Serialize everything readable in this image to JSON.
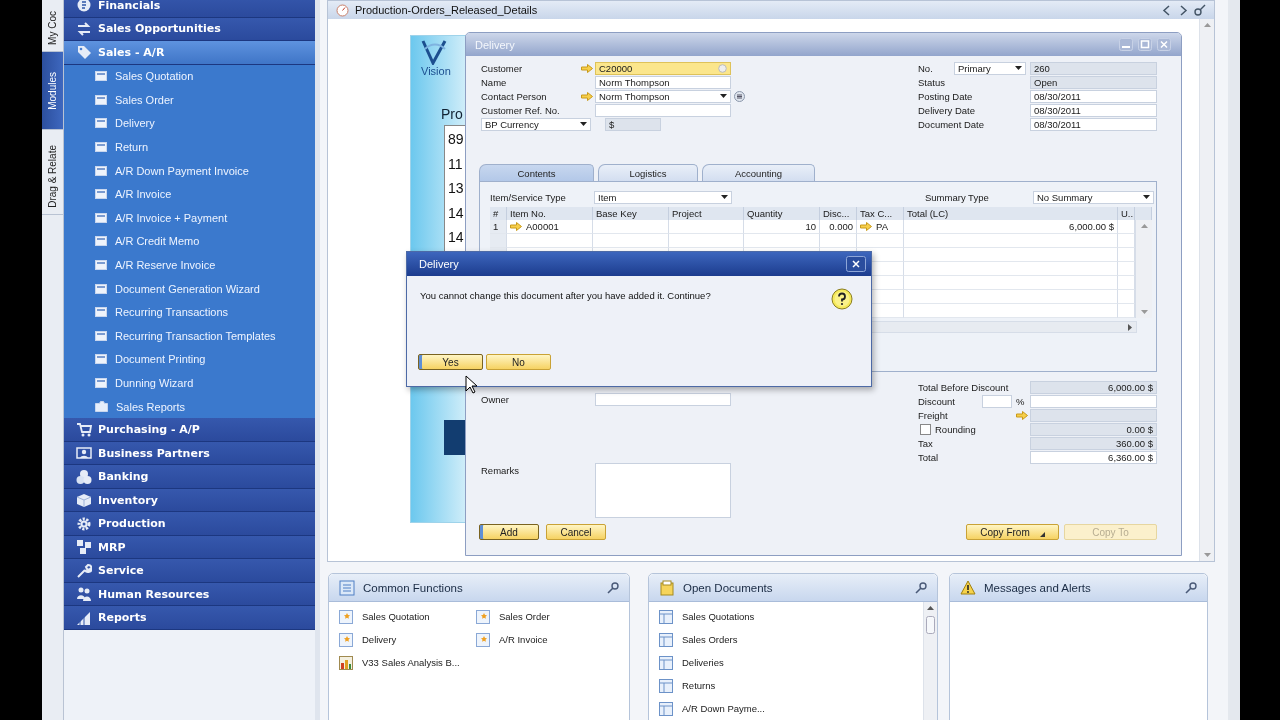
{
  "side_tabs": [
    {
      "label": "My Coc",
      "selected": false
    },
    {
      "label": "Modules",
      "selected": true
    },
    {
      "label": "Drag & Relate",
      "selected": false
    }
  ],
  "modules": [
    {
      "label": "Financials",
      "expanded": false
    },
    {
      "label": "Sales Opportunities",
      "expanded": false
    },
    {
      "label": "Sales - A/R",
      "expanded": true,
      "children": [
        {
          "label": "Sales Quotation",
          "kind": "form"
        },
        {
          "label": "Sales Order",
          "kind": "form"
        },
        {
          "label": "Delivery",
          "kind": "form"
        },
        {
          "label": "Return",
          "kind": "form"
        },
        {
          "label": "A/R Down Payment Invoice",
          "kind": "form"
        },
        {
          "label": "A/R Invoice",
          "kind": "form"
        },
        {
          "label": "A/R Invoice + Payment",
          "kind": "form"
        },
        {
          "label": "A/R Credit Memo",
          "kind": "form"
        },
        {
          "label": "A/R Reserve Invoice",
          "kind": "form"
        },
        {
          "label": "Document Generation Wizard",
          "kind": "form"
        },
        {
          "label": "Recurring Transactions",
          "kind": "form"
        },
        {
          "label": "Recurring Transaction Templates",
          "kind": "form"
        },
        {
          "label": "Document Printing",
          "kind": "form"
        },
        {
          "label": "Dunning Wizard",
          "kind": "form"
        },
        {
          "label": "Sales Reports",
          "kind": "folder"
        }
      ]
    },
    {
      "label": "Purchasing - A/P",
      "expanded": false
    },
    {
      "label": "Business Partners",
      "expanded": false
    },
    {
      "label": "Banking",
      "expanded": false
    },
    {
      "label": "Inventory",
      "expanded": false
    },
    {
      "label": "Production",
      "expanded": false
    },
    {
      "label": "MRP",
      "expanded": false
    },
    {
      "label": "Service",
      "expanded": false
    },
    {
      "label": "Human Resources",
      "expanded": false
    },
    {
      "label": "Reports",
      "expanded": false
    }
  ],
  "cockpit": {
    "title": "Production-Orders_Released_Details",
    "logo": "Vision",
    "heading": "Pro",
    "values": [
      "89",
      "11",
      "13",
      "14",
      "14"
    ]
  },
  "delivery": {
    "title": "Delivery",
    "header_left": [
      {
        "label": "Customer",
        "value": "C20000",
        "kind": "lookup",
        "link": true,
        "focused": true
      },
      {
        "label": "Name",
        "value": "Norm Thompson",
        "kind": "text",
        "link": false,
        "focused": false
      },
      {
        "label": "Contact Person",
        "value": "Norm Thompson",
        "kind": "dropdown",
        "link": true,
        "focused": false
      },
      {
        "label": "Customer Ref. No.",
        "kind": "text",
        "link": false,
        "focused": false
      },
      {
        "label": "BP Currency",
        "value": "$",
        "kind": "currency",
        "link": false,
        "focused": false
      }
    ],
    "header_right": [
      {
        "label": "No.",
        "series": "Primary",
        "value": "260",
        "kind": "series",
        "readonly": true
      },
      {
        "label": "Status",
        "value": "Open",
        "kind": "text",
        "readonly": true
      },
      {
        "label": "Posting Date",
        "value": "08/30/2011",
        "kind": "text",
        "readonly": false
      },
      {
        "label": "Delivery Date",
        "value": "08/30/2011",
        "kind": "text",
        "readonly": false
      },
      {
        "label": "Document Date",
        "value": "08/30/2011",
        "kind": "text",
        "readonly": false
      }
    ],
    "tabs": [
      {
        "label": "Contents",
        "selected": true
      },
      {
        "label": "Logistics",
        "selected": false
      },
      {
        "label": "Accounting",
        "selected": false
      }
    ],
    "item_type": {
      "label": "Item/Service Type",
      "value": "Item"
    },
    "summary_type": {
      "label": "Summary Type",
      "value": "No Summary"
    },
    "table": {
      "columns": [
        "#",
        "Item No.",
        "Base Key",
        "Project",
        "Quantity",
        "Disc...",
        "Tax C...",
        "Total (LC)",
        "U.."
      ],
      "rows": [
        {
          "number": "1",
          "item_no": "A00001",
          "quantity": "10",
          "discount": "0.000",
          "tax_code": "PA",
          "total": "6,000.00 $"
        }
      ]
    },
    "owner": {
      "label": "Owner"
    },
    "remarks": {
      "label": "Remarks"
    },
    "totals": [
      {
        "label": "Total Before Discount",
        "value": "6,000.00 $",
        "kind": "amount"
      },
      {
        "label": "Discount",
        "unit": "%",
        "kind": "discount"
      },
      {
        "label": "Freight",
        "kind": "link"
      },
      {
        "label": "Rounding",
        "value": "0.00 $",
        "kind": "checkbox",
        "checked": false
      },
      {
        "label": "Tax",
        "value": "360.00 $",
        "kind": "amount"
      },
      {
        "label": "Total",
        "value": "6,360.00 $",
        "kind": "total"
      }
    ],
    "buttons": [
      {
        "label": "Add",
        "kind": "default",
        "disabled": false
      },
      {
        "label": "Cancel",
        "kind": "plain",
        "disabled": false
      },
      {
        "label": "Copy From",
        "kind": "menu",
        "disabled": false
      },
      {
        "label": "Copy To",
        "kind": "plain",
        "disabled": true
      }
    ]
  },
  "dialog": {
    "title": "Delivery",
    "message": "You cannot change this document after you have added it. Continue?",
    "buttons": [
      {
        "label": "Yes",
        "focused": true
      },
      {
        "label": "No",
        "focused": false
      }
    ]
  },
  "widgets": [
    {
      "title": "Common Functions",
      "kind": "shortcuts",
      "items": [
        {
          "label": "Sales Quotation",
          "kind": "form"
        },
        {
          "label": "Sales Order",
          "kind": "form"
        },
        {
          "label": "Delivery",
          "kind": "form"
        },
        {
          "label": "A/R Invoice",
          "kind": "form"
        },
        {
          "label": "V33 Sales Analysis B...",
          "kind": "report"
        }
      ]
    },
    {
      "title": "Open Documents",
      "kind": "documents",
      "items": [
        {
          "label": "Sales Quotations",
          "kind": "list"
        },
        {
          "label": "Sales Orders",
          "kind": "list"
        },
        {
          "label": "Deliveries",
          "kind": "list"
        },
        {
          "label": "Returns",
          "kind": "list"
        },
        {
          "label": "A/R Down Payme...",
          "kind": "list"
        }
      ]
    },
    {
      "title": "Messages and Alerts",
      "kind": "alerts"
    }
  ]
}
